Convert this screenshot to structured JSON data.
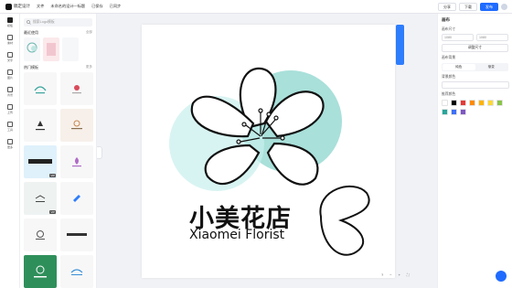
{
  "topbar": {
    "brand": "稿定设计",
    "items": [
      "文件",
      "未命名的设计—标题",
      "已保存",
      "已同步"
    ],
    "buttons": [
      "分享",
      "下载",
      "发布"
    ]
  },
  "rail": {
    "items": [
      "模板",
      "素材",
      "文字",
      "图片",
      "背景",
      "上传",
      "工具",
      "更多"
    ]
  },
  "panel": {
    "search_placeholder": "搜索Logo模板",
    "recent_title": "最近使用",
    "recent_more": "全部",
    "grid_title": "热门模板",
    "grid_more": "更多",
    "cards": [
      "",
      "",
      "",
      "",
      "",
      "",
      "",
      "",
      "",
      "",
      "",
      "",
      "",
      ""
    ],
    "vip": "VIP"
  },
  "canvas": {
    "title_zh": "小美花店",
    "title_en": "Xiaomei Florist",
    "accent": "#a9e0da"
  },
  "bottom_tools": [
    "?",
    "−",
    "+",
    "⛶"
  ],
  "props": {
    "title": "画布",
    "size_label": "画布尺寸",
    "width": "1080",
    "height": "1080",
    "resize_button": "调整尺寸",
    "bg_label": "画布背景",
    "seg": [
      "纯色",
      "渐变"
    ],
    "color_label": "背景颜色",
    "palette_label": "推荐颜色",
    "colors": [
      "#ffffff",
      "#000000",
      "#e53935",
      "#ff8a00",
      "#ffb300",
      "#fdd835",
      "#8bc34a",
      "#26a69a",
      "#3f6ff5",
      "#7e57c2"
    ]
  }
}
